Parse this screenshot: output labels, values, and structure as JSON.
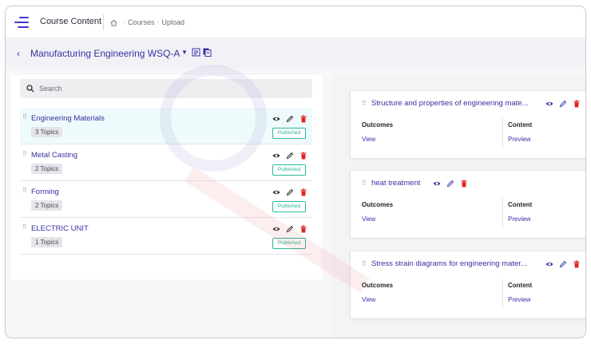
{
  "header": {
    "title": "Course Content",
    "breadcrumb": [
      "Courses",
      "Upload"
    ]
  },
  "course": {
    "title": "Manufacturing Engineering WSQ-A"
  },
  "search": {
    "placeholder": "Search"
  },
  "topics": [
    {
      "name": "Engineering Materials",
      "count": "3 Topics",
      "status": "Published",
      "active": true
    },
    {
      "name": "Metal Casting",
      "count": "2 Topics",
      "status": "Published",
      "active": false
    },
    {
      "name": "Forming",
      "count": "2 Topics",
      "status": "Published",
      "active": false
    },
    {
      "name": "ELECTRIC UNIT",
      "count": "1 Topics",
      "status": "Published",
      "active": false
    }
  ],
  "cards": [
    {
      "title": "Structure and properties of engineering mate...",
      "outcomes_label": "Outcomes",
      "outcomes_link": "View",
      "content_label": "Content",
      "content_link": "Preview"
    },
    {
      "title": "heat treatment",
      "outcomes_label": "Outcomes",
      "outcomes_link": "View",
      "content_label": "Content",
      "content_link": "Preview"
    },
    {
      "title": "Stress strain diagrams for engineering mater...",
      "outcomes_label": "Outcomes",
      "outcomes_link": "View",
      "content_label": "Content",
      "content_link": "Preview"
    }
  ],
  "colors": {
    "accent": "#3730a3",
    "delete": "#e02424",
    "published": "#2bb89c"
  },
  "icons": {
    "view": "eye-icon",
    "edit": "pencil-icon",
    "delete": "trash-icon",
    "drag": "drag-handle-icon"
  }
}
